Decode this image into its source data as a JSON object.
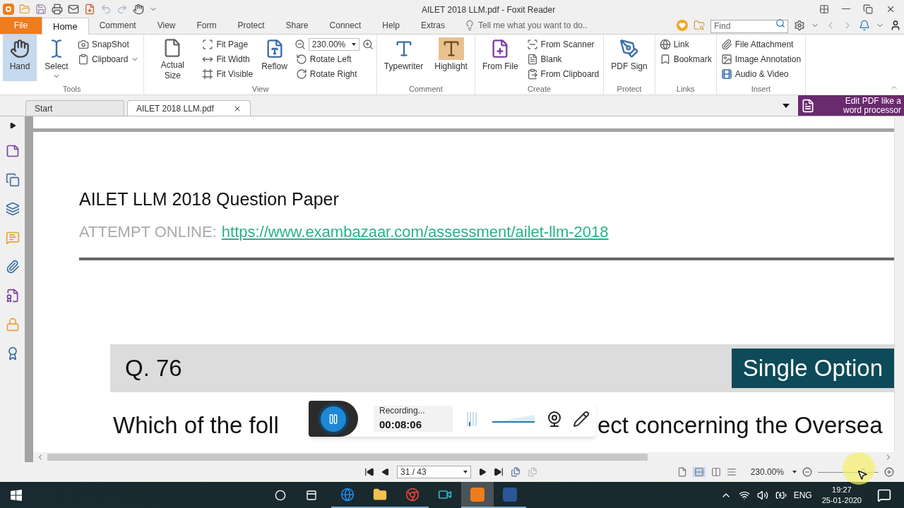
{
  "window": {
    "title": "AILET 2018 LLM.pdf - Foxit Reader"
  },
  "menu_tabs": [
    {
      "label": "File",
      "kind": "file",
      "selected": false
    },
    {
      "label": "Home",
      "kind": "tab",
      "selected": true
    },
    {
      "label": "Comment",
      "kind": "tab",
      "selected": false
    },
    {
      "label": "View",
      "kind": "tab",
      "selected": false
    },
    {
      "label": "Form",
      "kind": "tab",
      "selected": false
    },
    {
      "label": "Protect",
      "kind": "tab",
      "selected": false
    },
    {
      "label": "Share",
      "kind": "tab",
      "selected": false
    },
    {
      "label": "Connect",
      "kind": "tab",
      "selected": false
    },
    {
      "label": "Help",
      "kind": "tab",
      "selected": false
    },
    {
      "label": "Extras",
      "kind": "tab",
      "selected": false
    }
  ],
  "tell_me": {
    "placeholder": "Tell me what you want to do.."
  },
  "find": {
    "placeholder": "Find"
  },
  "ribbon": {
    "groups": [
      {
        "label": "Tools",
        "columns": [
          {
            "kind": "large",
            "label": "Hand",
            "selected": true,
            "dropdown": false
          },
          {
            "kind": "large",
            "label": "Select",
            "selected": false,
            "dropdown": true
          },
          {
            "kind": "stack",
            "items": [
              {
                "kind": "small",
                "label": "SnapShot",
                "dropdown": false
              },
              {
                "kind": "small",
                "label": "Clipboard",
                "dropdown": true
              }
            ]
          }
        ]
      },
      {
        "label": "View",
        "columns": [
          {
            "kind": "large",
            "label": "Actual Size",
            "selected": false,
            "dropdown": false
          },
          {
            "kind": "stack",
            "items": [
              {
                "kind": "small",
                "label": "Fit Page",
                "dropdown": false
              },
              {
                "kind": "small",
                "label": "Fit Width",
                "dropdown": false
              },
              {
                "kind": "small",
                "label": "Fit Visible",
                "dropdown": false
              }
            ]
          },
          {
            "kind": "large",
            "label": "Reflow",
            "selected": false,
            "dropdown": false
          },
          {
            "kind": "stack",
            "items": [
              {
                "kind": "zoom",
                "value": "230.00%"
              },
              {
                "kind": "small",
                "label": "Rotate Left",
                "dropdown": false
              },
              {
                "kind": "small",
                "label": "Rotate Right",
                "dropdown": false
              }
            ]
          }
        ]
      },
      {
        "label": "Comment",
        "columns": [
          {
            "kind": "large",
            "label": "Typewriter",
            "selected": false,
            "dropdown": false
          },
          {
            "kind": "large",
            "label": "Highlight",
            "selected": false,
            "dropdown": false
          }
        ]
      },
      {
        "label": "Create",
        "columns": [
          {
            "kind": "large",
            "label": "From File",
            "selected": false,
            "dropdown": false
          },
          {
            "kind": "stack",
            "items": [
              {
                "kind": "small",
                "label": "From Scanner",
                "dropdown": false
              },
              {
                "kind": "small",
                "label": "Blank",
                "dropdown": false
              },
              {
                "kind": "small",
                "label": "From Clipboard",
                "dropdown": false
              }
            ]
          }
        ]
      },
      {
        "label": "Protect",
        "columns": [
          {
            "kind": "large",
            "label": "PDF Sign",
            "selected": false,
            "dropdown": false
          }
        ]
      },
      {
        "label": "Links",
        "columns": [
          {
            "kind": "stack",
            "items": [
              {
                "kind": "small",
                "label": "Link",
                "dropdown": false
              },
              {
                "kind": "small",
                "label": "Bookmark",
                "dropdown": false
              }
            ]
          }
        ]
      },
      {
        "label": "Insert",
        "columns": [
          {
            "kind": "stack",
            "items": [
              {
                "kind": "small",
                "label": "File Attachment",
                "dropdown": false
              },
              {
                "kind": "small",
                "label": "Image Annotation",
                "dropdown": false
              },
              {
                "kind": "small",
                "label": "Audio & Video",
                "dropdown": false
              }
            ]
          }
        ]
      }
    ]
  },
  "doc_tabs": [
    {
      "label": "Start",
      "selected": false,
      "closable": false
    },
    {
      "label": "AILET 2018 LLM.pdf",
      "selected": true,
      "closable": true
    }
  ],
  "promo": {
    "text": "Edit PDF like a word processor"
  },
  "document": {
    "title": "AILET LLM 2018 Question Paper",
    "attempt_label": "ATTEMPT ONLINE:",
    "link": "https://www.exambazaar.com/assessment/ailet-llm-2018",
    "question_number": "Q. 76",
    "badge": "Single Option",
    "question_start": "Which of the foll",
    "question_end": "ect concerning the Oversea"
  },
  "recorder": {
    "status": "Recording...",
    "time": "00:08:06",
    "volume": {
      "level": 0.97
    }
  },
  "status_bar": {
    "page": "31 / 43",
    "zoom": "230.00%",
    "zoom_level": {
      "level": 0.72
    }
  },
  "taskbar": {
    "apps": [
      {
        "running": true,
        "selected": false
      },
      {
        "running": true,
        "selected": false
      },
      {
        "running": true,
        "selected": false
      },
      {
        "running": false,
        "selected": false
      },
      {
        "running": true,
        "selected": true
      },
      {
        "running": true,
        "selected": false
      }
    ],
    "language": "ENG",
    "time": "19:27",
    "date": "25-01-2020"
  }
}
